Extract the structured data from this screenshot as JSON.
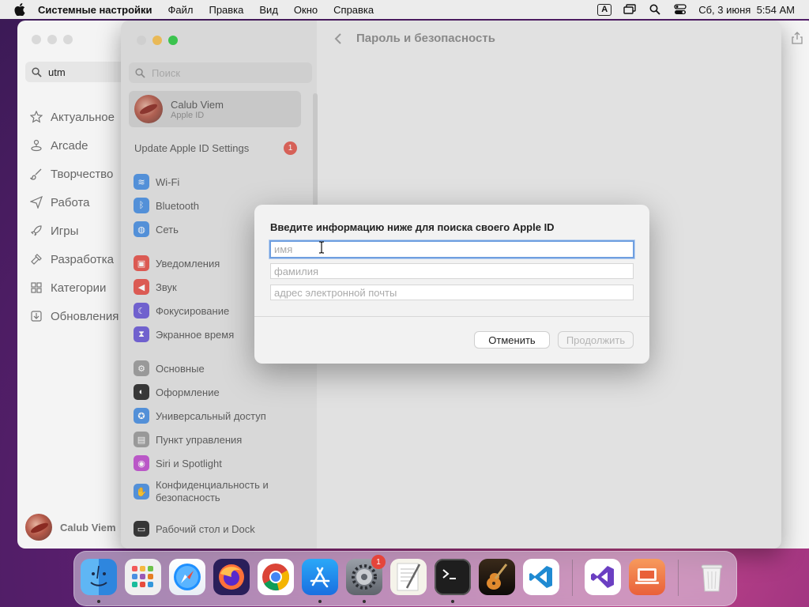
{
  "menubar": {
    "app_name": "Системные настройки",
    "items": [
      "Файл",
      "Правка",
      "Вид",
      "Окно",
      "Справка"
    ],
    "input_indicator": "A",
    "datetime": "Сб, 3 июня  5:54 AM"
  },
  "app_store": {
    "search_value": "utm",
    "nav": [
      {
        "label": "Актуальное",
        "icon": "star-icon"
      },
      {
        "label": "Arcade",
        "icon": "joystick-icon"
      },
      {
        "label": "Творчество",
        "icon": "brush-icon"
      },
      {
        "label": "Работа",
        "icon": "paper-plane-icon"
      },
      {
        "label": "Игры",
        "icon": "rocket-icon"
      },
      {
        "label": "Разработка",
        "icon": "hammer-icon"
      },
      {
        "label": "Категории",
        "icon": "grid-icon"
      },
      {
        "label": "Обновления",
        "icon": "download-icon"
      }
    ],
    "user_name": "Calub Viem"
  },
  "settings": {
    "header_title": "Пароль и безопасность",
    "search_placeholder": "Поиск",
    "profile": {
      "name": "Calub Viem",
      "subtitle": "Apple ID"
    },
    "update_row": {
      "label": "Update Apple ID Settings",
      "badge": "1"
    },
    "sidebar_items": [
      {
        "label": "Wi-Fi",
        "color": "#4a90e2",
        "glyph": "≋"
      },
      {
        "label": "Bluetooth",
        "color": "#4a90e2",
        "glyph": "ᛒ"
      },
      {
        "label": "Сеть",
        "color": "#4a90e2",
        "glyph": "◍"
      },
      {
        "label": "Уведомления",
        "color": "#e5534b",
        "glyph": "▣"
      },
      {
        "label": "Звук",
        "color": "#e5534b",
        "glyph": "◀"
      },
      {
        "label": "Фокусирование",
        "color": "#6b5bd6",
        "glyph": "☾"
      },
      {
        "label": "Экранное время",
        "color": "#6b5bd6",
        "glyph": "⧗"
      },
      {
        "label": "Основные",
        "color": "#9a9a9a",
        "glyph": "⚙"
      },
      {
        "label": "Оформление",
        "color": "#2b2b2b",
        "glyph": "◐"
      },
      {
        "label": "Универсальный доступ",
        "color": "#4a90e2",
        "glyph": "✪"
      },
      {
        "label": "Пункт управления",
        "color": "#9a9a9a",
        "glyph": "▤"
      },
      {
        "label": "Siri и Spotlight",
        "color": "#c04fcf",
        "glyph": "◉"
      },
      {
        "label": "Конфиденциальность и",
        "label2": "безопасность",
        "color": "#4a90e2",
        "glyph": "✋"
      },
      {
        "label": "Рабочий стол и Dock",
        "color": "#2b2b2b",
        "glyph": "▭"
      }
    ]
  },
  "dialog": {
    "title": "Введите информацию ниже для поиска своего Apple ID",
    "first_name_placeholder": "имя",
    "last_name_placeholder": "фамилия",
    "email_placeholder": "адрес электронной почты",
    "first_name_value": "",
    "last_name_value": "",
    "email_value": "",
    "cancel_label": "Отменить",
    "continue_label": "Продолжить"
  },
  "dock": {
    "settings_badge": "1",
    "apps": [
      "Finder",
      "Launchpad",
      "Safari",
      "Firefox",
      "Chrome",
      "App Store",
      "System Settings",
      "TextEdit",
      "Terminal",
      "GarageBand",
      "Visual Studio Code",
      "Visual Studio",
      "UTM",
      "Trash"
    ]
  }
}
